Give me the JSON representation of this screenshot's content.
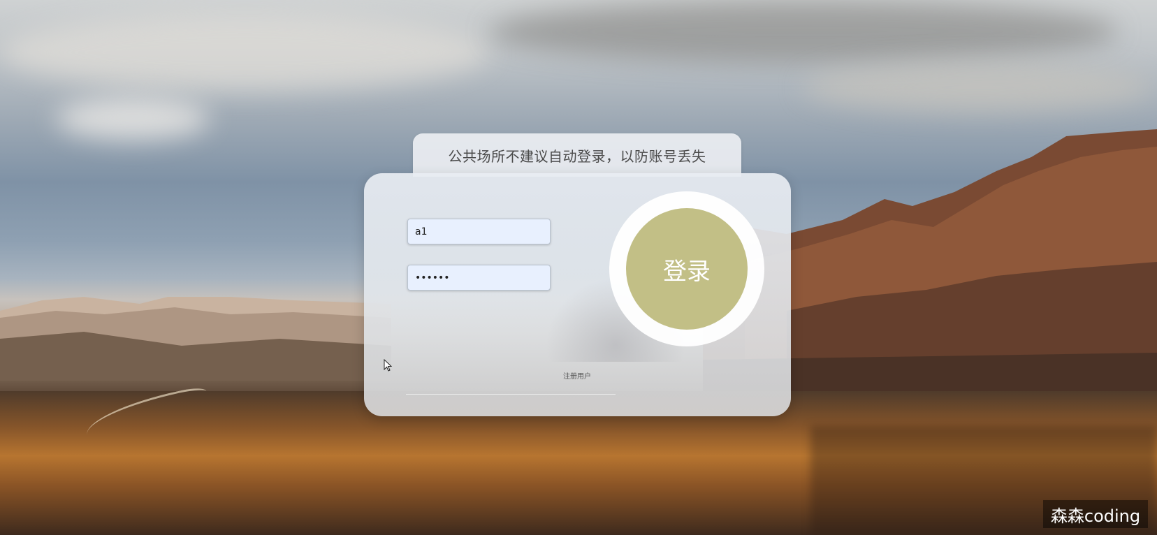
{
  "notice": {
    "text": "公共场所不建议自动登录，以防账号丢失"
  },
  "login_form": {
    "username_value": "a1",
    "password_value": "••••••",
    "login_button_label": "登录",
    "register_link_label": "注册用户"
  },
  "watermark": {
    "text": "森森coding"
  },
  "colors": {
    "login_button": "#c2bf86",
    "field_background": "#e8f0fe",
    "card_background": "#e6eaef"
  }
}
